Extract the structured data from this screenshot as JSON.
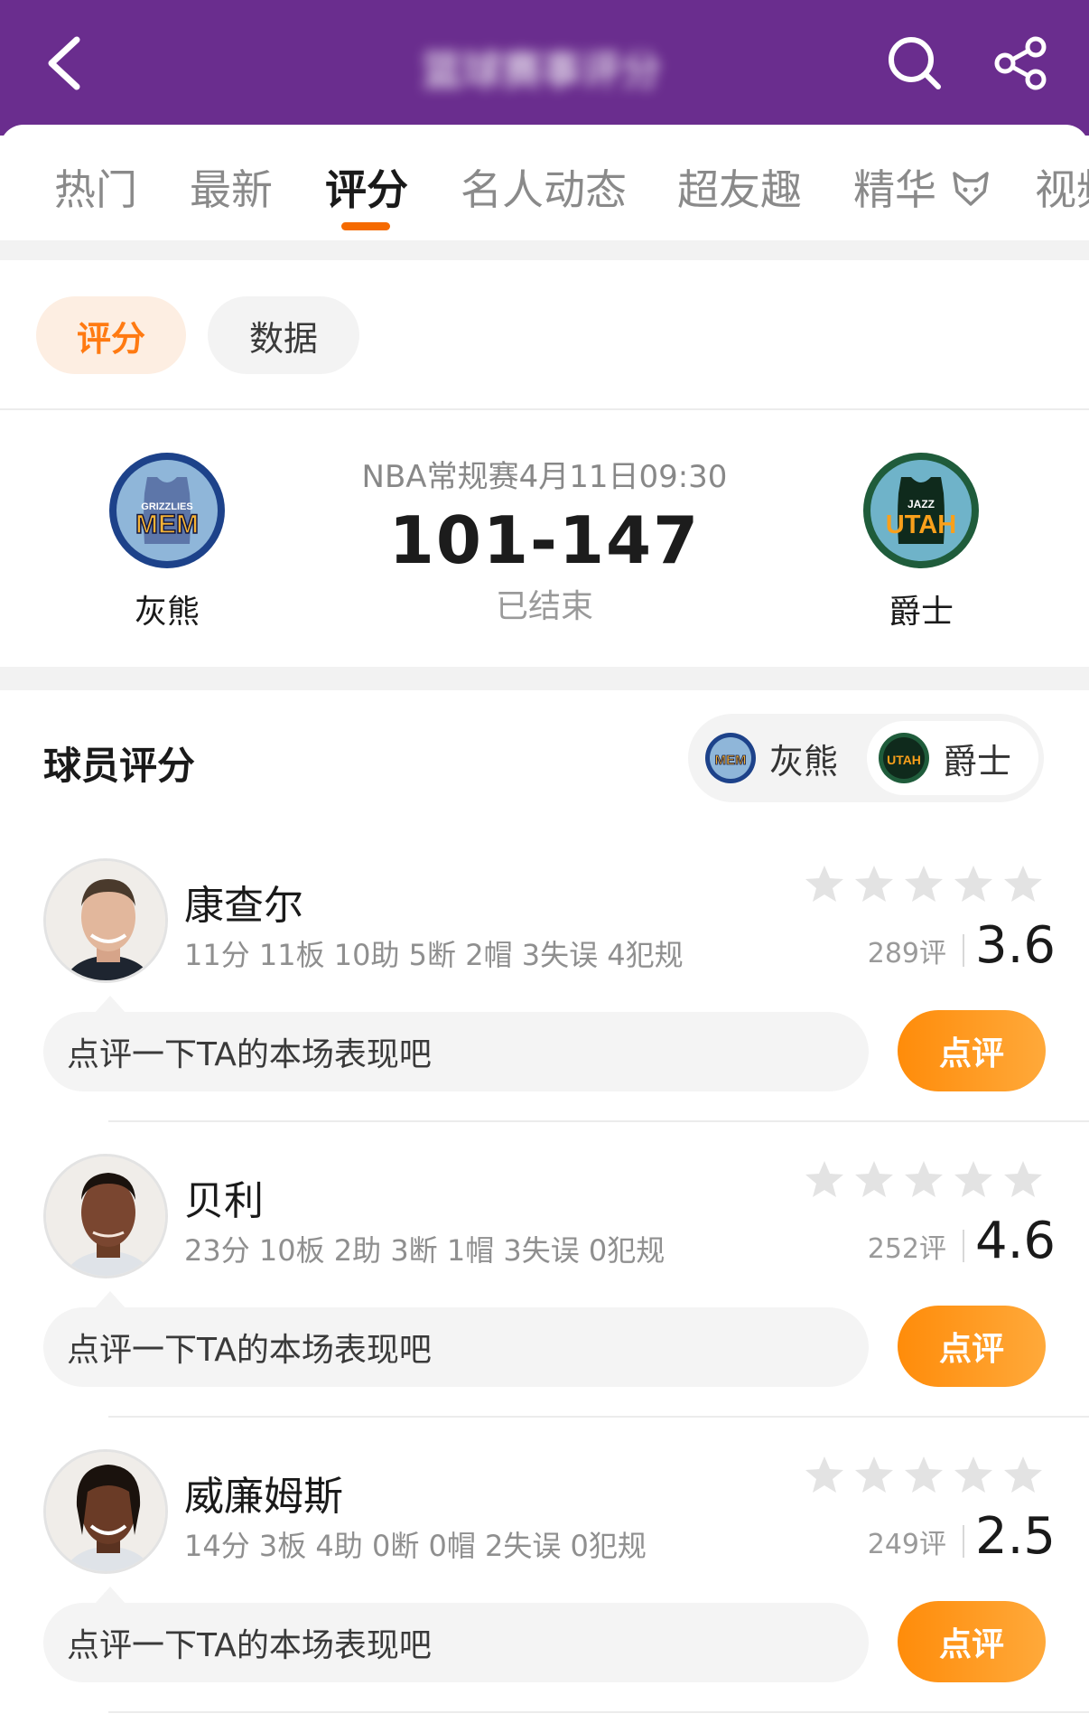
{
  "header": {
    "title": "篮球赛事评分",
    "colors": {
      "bar": "#6a2d8e",
      "icon": "#ffffff"
    },
    "icons": [
      "chevron-left-icon",
      "search-icon",
      "share-icon"
    ]
  },
  "tabs": [
    {
      "label": "热门"
    },
    {
      "label": "最新"
    },
    {
      "label": "评分",
      "active": true
    },
    {
      "label": "名人动态"
    },
    {
      "label": "超友趣"
    },
    {
      "label": "精华"
    },
    {
      "label": "视频"
    }
  ],
  "subtabs": {
    "rating": "评分",
    "data": "数据",
    "active": "rating"
  },
  "match": {
    "info": "NBA常规赛4月11日09:30",
    "score": "101-147",
    "status": "已结束",
    "home": {
      "name": "灰熊",
      "logo_text": "MEM",
      "logo_sub": "GRIZZLIES",
      "color": "#1d428a"
    },
    "away": {
      "name": "爵士",
      "logo_text": "UTAH",
      "logo_sub": "JAZZ",
      "color": "#0f2a1c",
      "accent": "#f9a01b"
    }
  },
  "ratings": {
    "title": "球员评分",
    "team_switch": {
      "home": "灰熊",
      "away": "爵士",
      "selected": "away"
    },
    "comment_placeholder": "点评一下TA的本场表现吧",
    "rate_button": "点评",
    "players": [
      {
        "name": "康查尔",
        "stats": "11分 11板 10助 5断 2帽 3失误 4犯规",
        "count": "289评",
        "score": "3.6"
      },
      {
        "name": "贝利",
        "stats": "23分 10板 2助 3断 1帽 3失误 0犯规",
        "count": "252评",
        "score": "4.6"
      },
      {
        "name": "威廉姆斯",
        "stats": "14分 3板 4助 0断 0帽 2失误 0犯规",
        "count": "249评",
        "score": "2.5"
      }
    ]
  },
  "colors": {
    "accent": "#ff7a12",
    "star": "#e3e3e3"
  }
}
